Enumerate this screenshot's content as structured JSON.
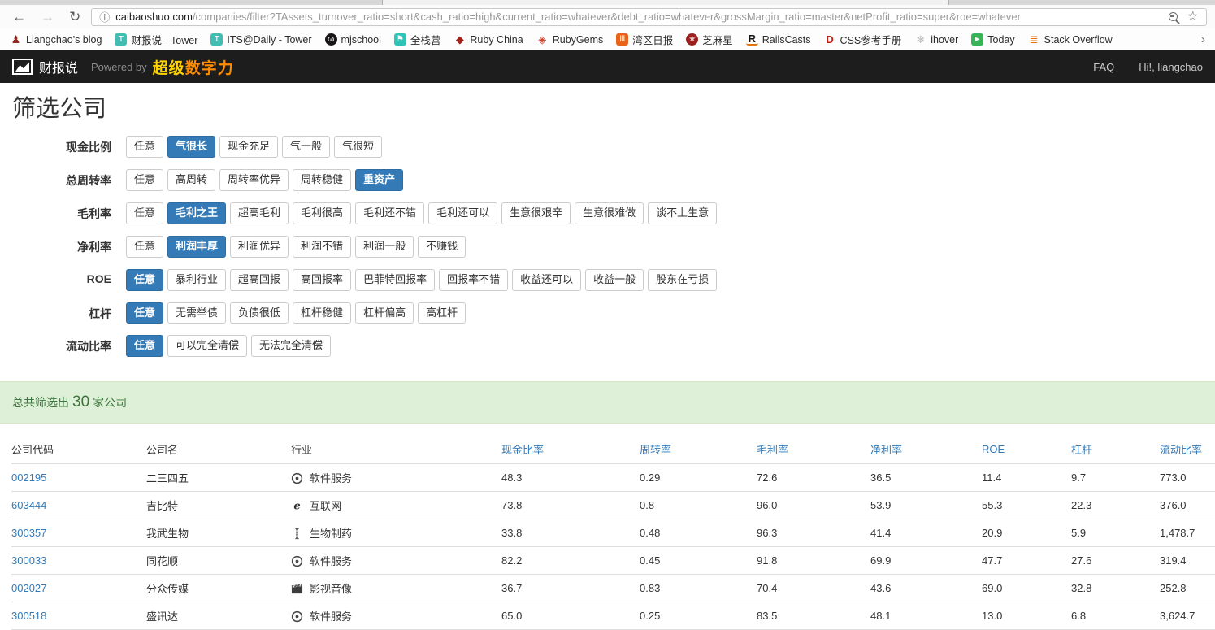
{
  "browser": {
    "url_domain": "caibaoshuo.com",
    "url_path": "/companies/filter?TAssets_turnover_ratio=short&cash_ratio=high&current_ratio=whatever&debt_ratio=whatever&grossMargin_ratio=master&netProfit_ratio=super&roe=whatever",
    "icons": {
      "back": "←",
      "forward": "→",
      "refresh": "↻",
      "info": "ⓘ",
      "star": "☆",
      "overflow": "›"
    }
  },
  "bookmarks": [
    {
      "label": "Liangchao's blog",
      "icon": "person-icon",
      "glyph": "♟",
      "fg": "#8e2b24",
      "bg": "none",
      "big": true
    },
    {
      "label": "财报说 - Tower",
      "icon": "tower-icon",
      "glyph": "T",
      "fg": "#ffffff",
      "bg": "#41bdb4"
    },
    {
      "label": "ITS@Daily - Tower",
      "icon": "tower-icon",
      "glyph": "T",
      "fg": "#ffffff",
      "bg": "#41bdb4"
    },
    {
      "label": "mjschool",
      "icon": "github-icon",
      "glyph": "ω",
      "fg": "#ffffff",
      "bg": "#191717",
      "round": true
    },
    {
      "label": "全栈营",
      "icon": "flag-icon",
      "glyph": "⚑",
      "fg": "#ffffff",
      "bg": "#2ec4b6"
    },
    {
      "label": "Ruby China",
      "icon": "ruby-icon",
      "glyph": "◆",
      "fg": "#a2201a",
      "bg": "none",
      "big": true
    },
    {
      "label": "RubyGems",
      "icon": "rubygems-icon",
      "glyph": "◈",
      "fg": "#d34231",
      "bg": "none",
      "big": true
    },
    {
      "label": "湾区日报",
      "icon": "barchart-icon",
      "glyph": "Ⅲ",
      "fg": "#ffffff",
      "bg": "#e8641b"
    },
    {
      "label": "芝麻星",
      "icon": "sesame-icon",
      "glyph": "★",
      "fg": "#e8c8c8",
      "bg": "#99201e",
      "round": true
    },
    {
      "label": "RailsCasts",
      "icon": "railscasts-icon",
      "glyph": "R",
      "fg": "#141414",
      "bg": "none",
      "bold": true,
      "underline": "#e8730c",
      "big": true
    },
    {
      "label": "CSS参考手册",
      "icon": "css-handbook-icon",
      "glyph": "D",
      "fg": "#c21f12",
      "bg": "none",
      "bold": true,
      "big": true
    },
    {
      "label": "ihover",
      "icon": "snowflake-icon",
      "glyph": "❄",
      "fg": "#b9b9b9",
      "bg": "none",
      "big": true
    },
    {
      "label": "Today",
      "icon": "today-icon",
      "glyph": "▸",
      "fg": "#ffffff",
      "bg": "#35b558"
    },
    {
      "label": "Stack Overflow",
      "icon": "stackoverflow-icon",
      "glyph": "≣",
      "fg": "#e8730c",
      "bg": "none",
      "big": true
    }
  ],
  "header": {
    "brand": "财报说",
    "powered_by": "Powered by",
    "brand_super": "超级",
    "brand_power": "数字力",
    "faq": "FAQ",
    "greeting": "Hi!, liangchao"
  },
  "page_title": "筛选公司",
  "filters": [
    {
      "label": "现金比例",
      "options": [
        {
          "t": "任意"
        },
        {
          "t": "气很长",
          "sel": true
        },
        {
          "t": "现金充足"
        },
        {
          "t": "气一般"
        },
        {
          "t": "气很短"
        }
      ]
    },
    {
      "label": "总周转率",
      "options": [
        {
          "t": "任意"
        },
        {
          "t": "高周转"
        },
        {
          "t": "周转率优异"
        },
        {
          "t": "周转稳健"
        },
        {
          "t": "重资产",
          "sel": true
        }
      ]
    },
    {
      "label": "毛利率",
      "options": [
        {
          "t": "任意"
        },
        {
          "t": "毛利之王",
          "sel": true
        },
        {
          "t": "超高毛利"
        },
        {
          "t": "毛利很高"
        },
        {
          "t": "毛利还不错"
        },
        {
          "t": "毛利还可以"
        },
        {
          "t": "生意很艰辛"
        },
        {
          "t": "生意很难做"
        },
        {
          "t": "谈不上生意"
        }
      ]
    },
    {
      "label": "净利率",
      "options": [
        {
          "t": "任意"
        },
        {
          "t": "利润丰厚",
          "sel": true
        },
        {
          "t": "利润优异"
        },
        {
          "t": "利润不错"
        },
        {
          "t": "利润一般"
        },
        {
          "t": "不赚钱"
        }
      ]
    },
    {
      "label": "ROE",
      "options": [
        {
          "t": "任意",
          "sel": true
        },
        {
          "t": "暴利行业"
        },
        {
          "t": "超高回报"
        },
        {
          "t": "高回报率"
        },
        {
          "t": "巴菲特回报率"
        },
        {
          "t": "回报率不错"
        },
        {
          "t": "收益还可以"
        },
        {
          "t": "收益一般"
        },
        {
          "t": "股东在亏损"
        }
      ]
    },
    {
      "label": "杠杆",
      "options": [
        {
          "t": "任意",
          "sel": true
        },
        {
          "t": "无需举债"
        },
        {
          "t": "负债很低"
        },
        {
          "t": "杠杆稳健"
        },
        {
          "t": "杠杆偏高"
        },
        {
          "t": "高杠杆"
        }
      ]
    },
    {
      "label": "流动比率",
      "options": [
        {
          "t": "任意",
          "sel": true
        },
        {
          "t": "可以完全清偿"
        },
        {
          "t": "无法完全清偿"
        }
      ]
    }
  ],
  "summary": {
    "prefix": "总共筛选出",
    "count": "30",
    "suffix": "家公司"
  },
  "table": {
    "headers": [
      {
        "label": "公司代码"
      },
      {
        "label": "公司名"
      },
      {
        "label": "行业"
      },
      {
        "label": "现金比率",
        "sortable": true
      },
      {
        "label": "周转率",
        "sortable": true
      },
      {
        "label": "毛利率",
        "sortable": true
      },
      {
        "label": "净利率",
        "sortable": true
      },
      {
        "label": "ROE",
        "sortable": true
      },
      {
        "label": "杠杆",
        "sortable": true
      },
      {
        "label": "流动比率",
        "sortable": true
      }
    ],
    "rows": [
      {
        "code": "002195",
        "name": "二三四五",
        "industry": "软件服务",
        "industry_icon": "software-icon",
        "values": [
          "48.3",
          "0.29",
          "72.6",
          "36.5",
          "11.4",
          "9.7",
          "773.0"
        ]
      },
      {
        "code": "603444",
        "name": "吉比特",
        "industry": "互联网",
        "industry_icon": "internet-icon",
        "values": [
          "73.8",
          "0.8",
          "96.0",
          "53.9",
          "55.3",
          "22.3",
          "376.0"
        ]
      },
      {
        "code": "300357",
        "name": "我武生物",
        "industry": "生物制药",
        "industry_icon": "biotech-icon",
        "values": [
          "33.8",
          "0.48",
          "96.3",
          "41.4",
          "20.9",
          "5.9",
          "1,478.7"
        ]
      },
      {
        "code": "300033",
        "name": "同花顺",
        "industry": "软件服务",
        "industry_icon": "software-icon",
        "values": [
          "82.2",
          "0.45",
          "91.8",
          "69.9",
          "47.7",
          "27.6",
          "319.4"
        ]
      },
      {
        "code": "002027",
        "name": "分众传媒",
        "industry": "影视音像",
        "industry_icon": "media-icon",
        "values": [
          "36.7",
          "0.83",
          "70.4",
          "43.6",
          "69.0",
          "32.8",
          "252.8"
        ]
      },
      {
        "code": "300518",
        "name": "盛讯达",
        "industry": "软件服务",
        "industry_icon": "software-icon",
        "values": [
          "65.0",
          "0.25",
          "83.5",
          "48.1",
          "13.0",
          "6.8",
          "3,624.7"
        ]
      }
    ]
  },
  "colors": {
    "accent": "#337ab7",
    "header_bg": "#1d1d1d",
    "alert_bg": "#dff0d8",
    "alert_text": "#3c763d",
    "brand_super": "#ffd400",
    "brand_power": "#ff8c00"
  }
}
